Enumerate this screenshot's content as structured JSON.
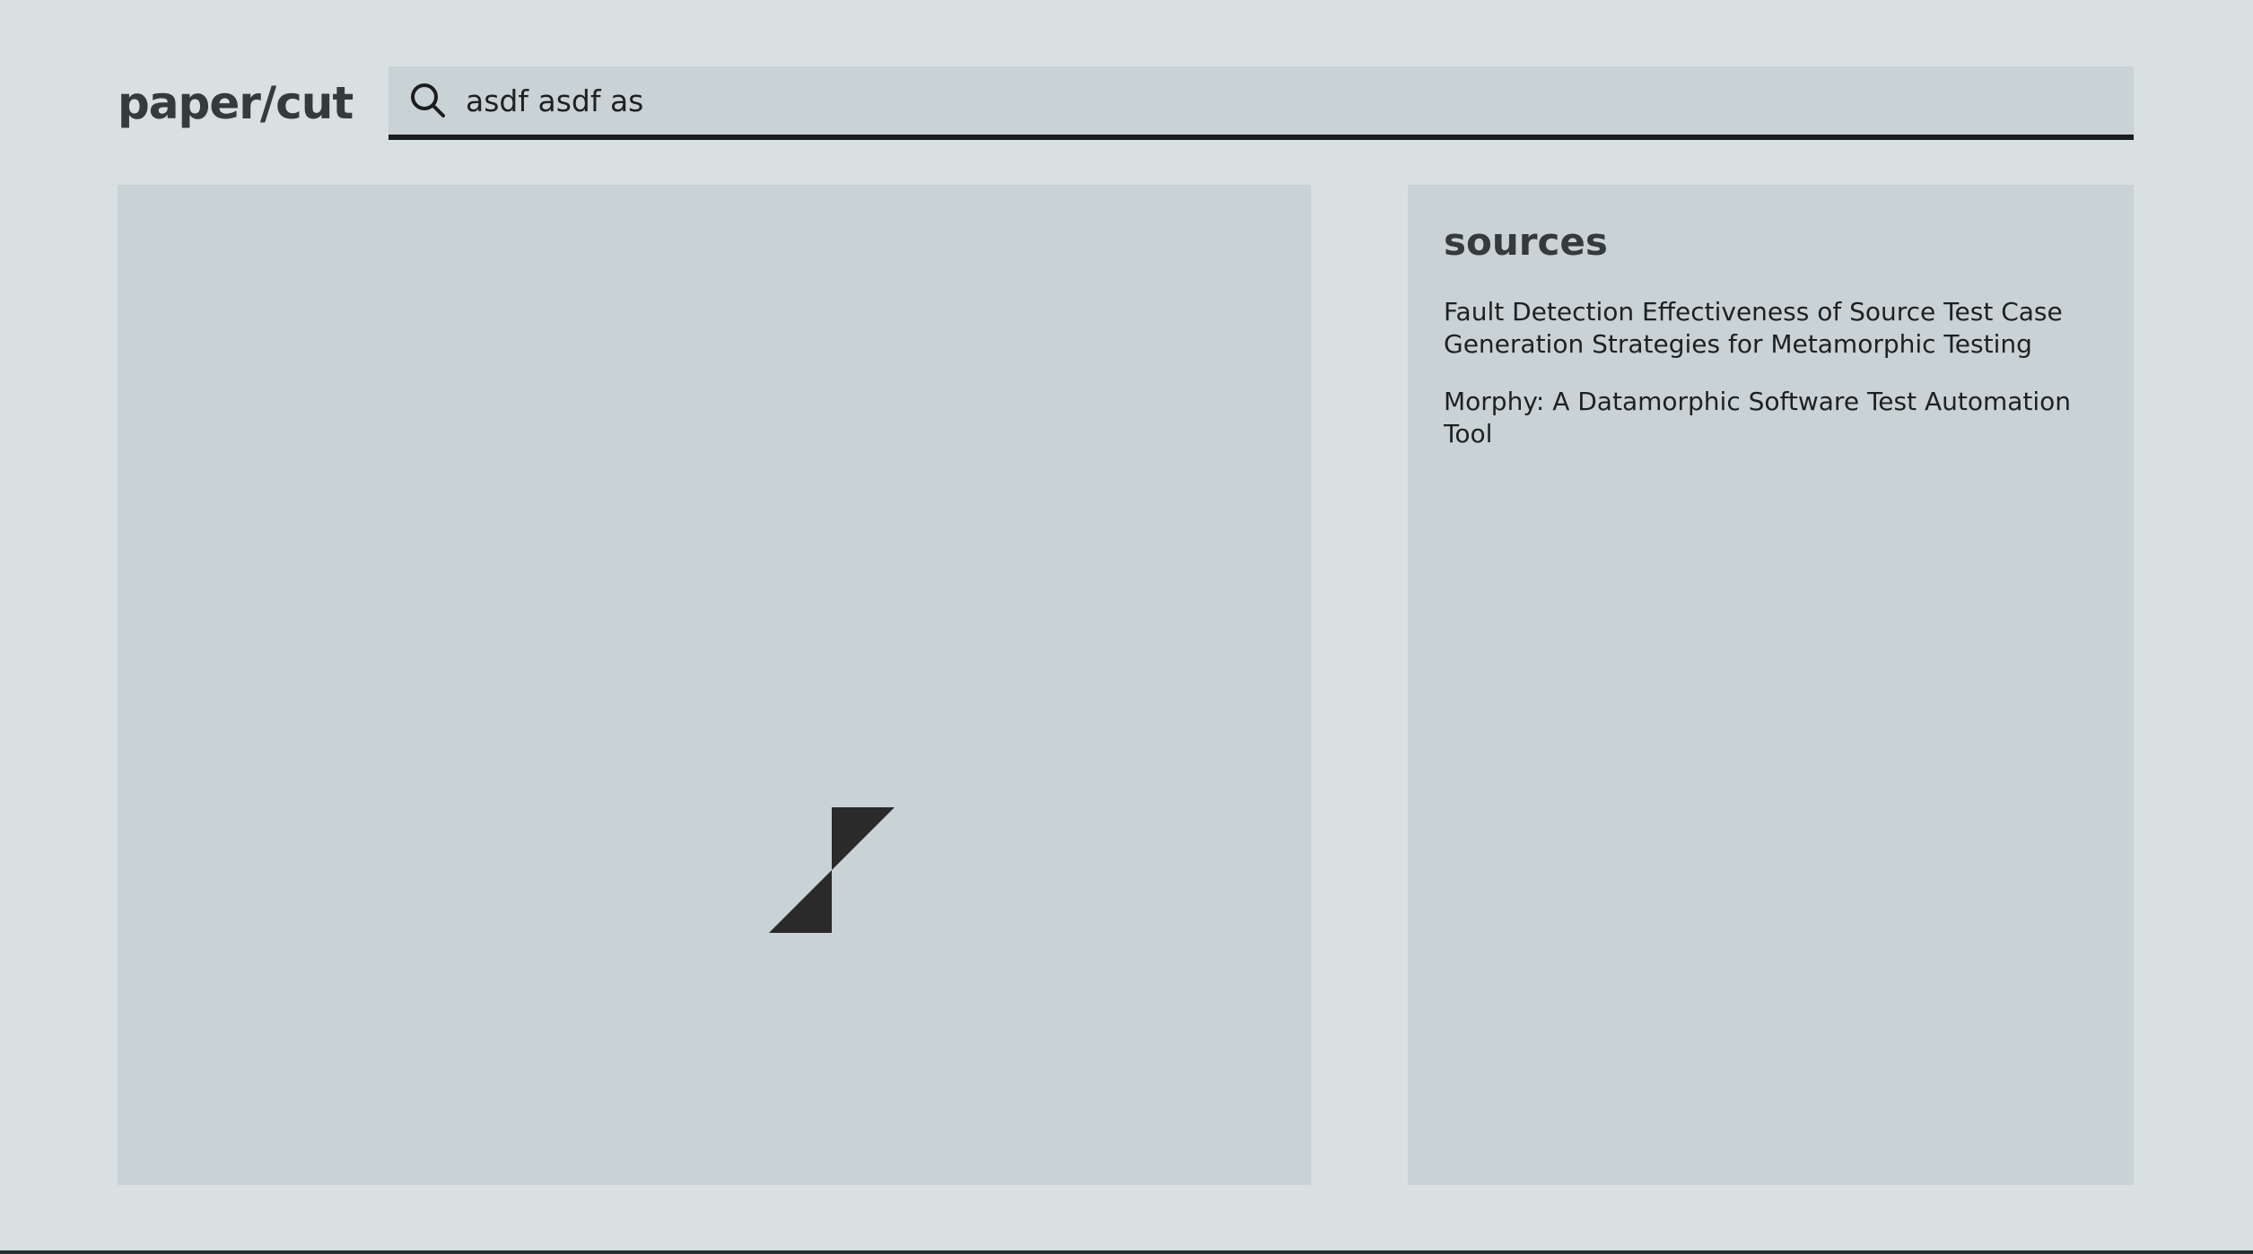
{
  "app": {
    "logo": "paper/cut"
  },
  "search": {
    "value": "asdf asdf as",
    "icon": "search-icon"
  },
  "viewer": {
    "loader_icon": "hourglass-loader-icon",
    "loader_color": "#2a2a2a"
  },
  "sources": {
    "title": "sources",
    "items": [
      {
        "label": "Fault Detection Effectiveness of Source Test Case Generation Strategies for Metamorphic Testing"
      },
      {
        "label": "Morphy: A Datamorphic Software Test Automation Tool"
      }
    ]
  },
  "colors": {
    "background": "#d8e0e1",
    "panel": "#c9d2d4",
    "text": "#2a2d2e",
    "accent": "#1b1d1e"
  }
}
